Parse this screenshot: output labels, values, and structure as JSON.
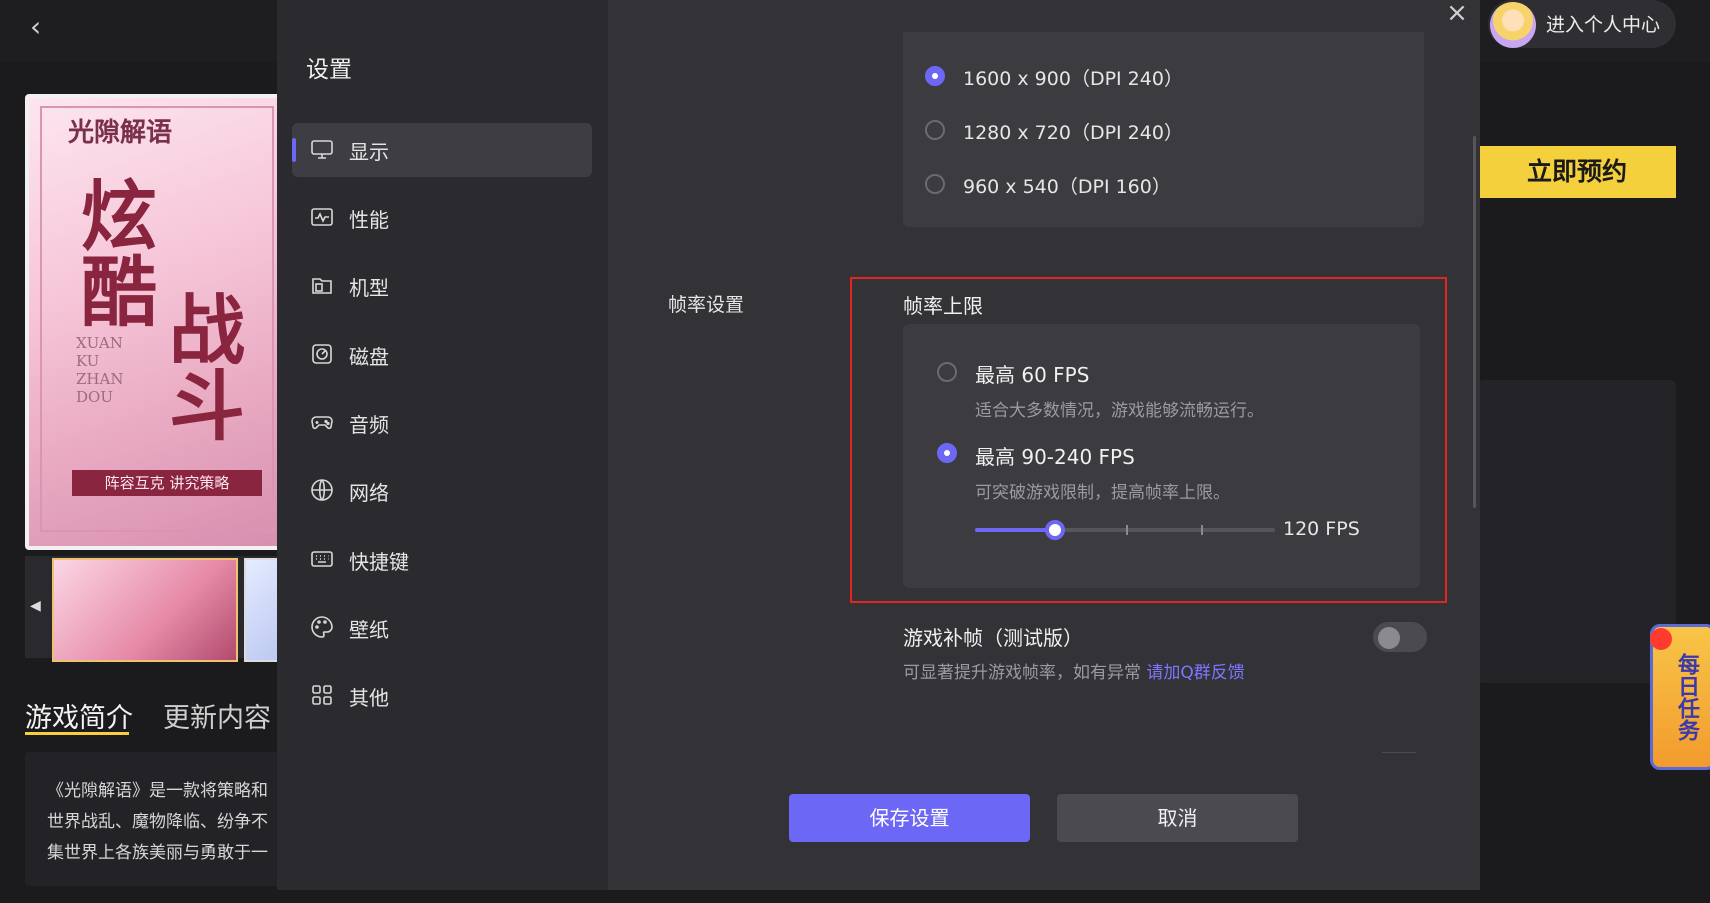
{
  "background_app": {
    "user_center_label": "进入个人中心",
    "reserve_button": "立即预约",
    "daily_task": "每日任务",
    "cover": {
      "logo_text": "光隙解语",
      "title_chars_1": "炫酷",
      "title_chars_2": "战斗",
      "title_english": "XUAN KU ZHAN DOU",
      "tagline": "阵容互克 讲究策略"
    },
    "tabs": [
      "游戏简介",
      "更新内容"
    ],
    "description_lines": [
      "《光隙解语》是一款将策略和",
      "世界战乱、魔物降临、纷争不",
      "集世界上各族美丽与勇敢于一"
    ]
  },
  "modal": {
    "title": "设置",
    "nav_items": [
      {
        "label": "显示",
        "icon": "monitor-icon",
        "active": true
      },
      {
        "label": "性能",
        "icon": "performance-icon",
        "active": false
      },
      {
        "label": "机型",
        "icon": "device-model-icon",
        "active": false
      },
      {
        "label": "磁盘",
        "icon": "disk-icon",
        "active": false
      },
      {
        "label": "音频",
        "icon": "gamepad-audio-icon",
        "active": false
      },
      {
        "label": "网络",
        "icon": "globe-icon",
        "active": false
      },
      {
        "label": "快捷键",
        "icon": "keyboard-icon",
        "active": false
      },
      {
        "label": "壁纸",
        "icon": "palette-icon",
        "active": false
      },
      {
        "label": "其他",
        "icon": "grid-icon",
        "active": false
      }
    ],
    "resolutions": [
      {
        "label": "1600 x 900（DPI 240）",
        "selected": true
      },
      {
        "label": "1280 x 720（DPI 240）",
        "selected": false
      },
      {
        "label": "960 x 540（DPI 160）",
        "selected": false
      }
    ],
    "frame_rate": {
      "section_label": "帧率设置",
      "cap_title": "帧率上限",
      "options": [
        {
          "title": "最高 60 FPS",
          "desc": "适合大多数情况，游戏能够流畅运行。",
          "selected": false
        },
        {
          "title": "最高 90-240 FPS",
          "desc": "可突破游戏限制，提高帧率上限。",
          "selected": true
        }
      ],
      "slider_value_label": "120 FPS",
      "slider_fraction": 0.25
    },
    "interpolation": {
      "title": "游戏补帧（测试版）",
      "desc": "可显著提升游戏帧率，如有异常 ",
      "link": "请加Q群反馈",
      "enabled": false
    },
    "save_label": "保存设置",
    "cancel_label": "取消"
  },
  "colors": {
    "accent": "#6d67f5",
    "highlight_border": "#e0261f",
    "reserve": "#f3d03c"
  }
}
